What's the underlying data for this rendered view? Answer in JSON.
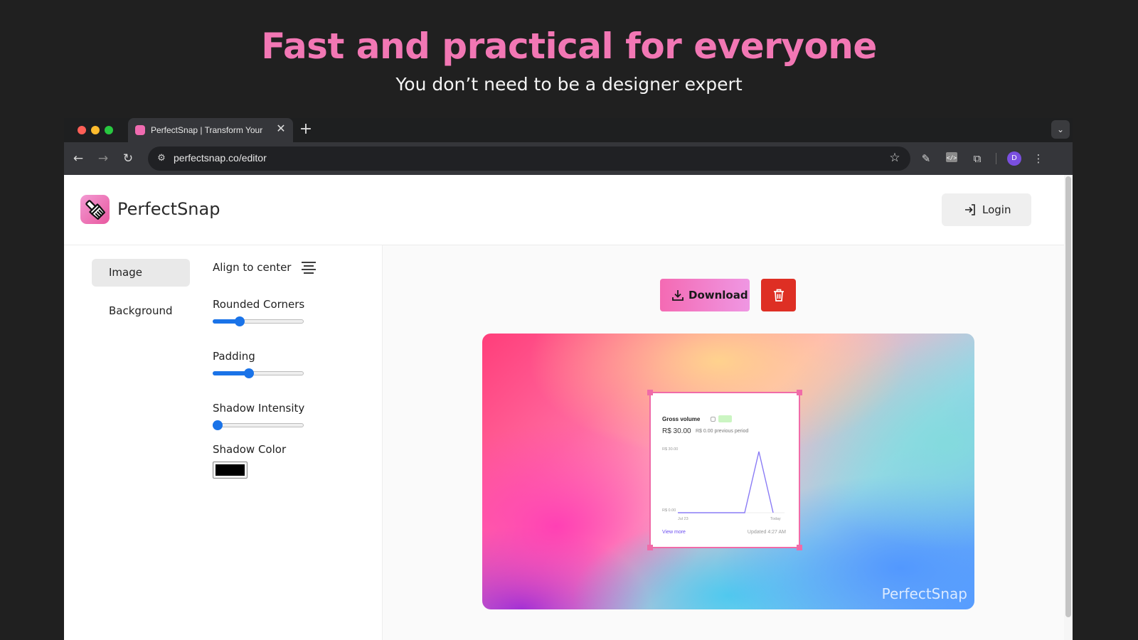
{
  "hero": {
    "title": "Fast and practical for everyone",
    "subtitle": "You don’t need to be a designer expert"
  },
  "browser": {
    "tab_title": "PerfectSnap | Transform Your",
    "tab_close": "✕",
    "new_tab": "+",
    "url": "perfectsnap.co/editor",
    "profile_initial": "D"
  },
  "app": {
    "brand": "PerfectSnap",
    "login_label": "Login",
    "nav": {
      "image": "Image",
      "background": "Background"
    },
    "controls": {
      "align": "Align to center",
      "rounded_corners": {
        "label": "Rounded Corners",
        "value": 0.27
      },
      "padding": {
        "label": "Padding",
        "value": 0.39
      },
      "shadow_intensity": {
        "label": "Shadow Intensity",
        "value": 0.0
      },
      "shadow_color": {
        "label": "Shadow Color",
        "color": "#000000"
      }
    },
    "download_label": "Download",
    "accent": "#f277b4",
    "delete_color": "#de2f24"
  },
  "preview": {
    "watermark": "PerfectSnap",
    "card": {
      "title": "Gross volume",
      "badge": "",
      "value": "R$ 30.00",
      "previous": "R$ 0.00 previous period",
      "y_top": "R$ 30.00",
      "y_bottom": "R$ 0.00",
      "x_start": "Jul 23",
      "x_end": "Today",
      "link": "View more",
      "updated": "Updated 4:27 AM"
    }
  }
}
